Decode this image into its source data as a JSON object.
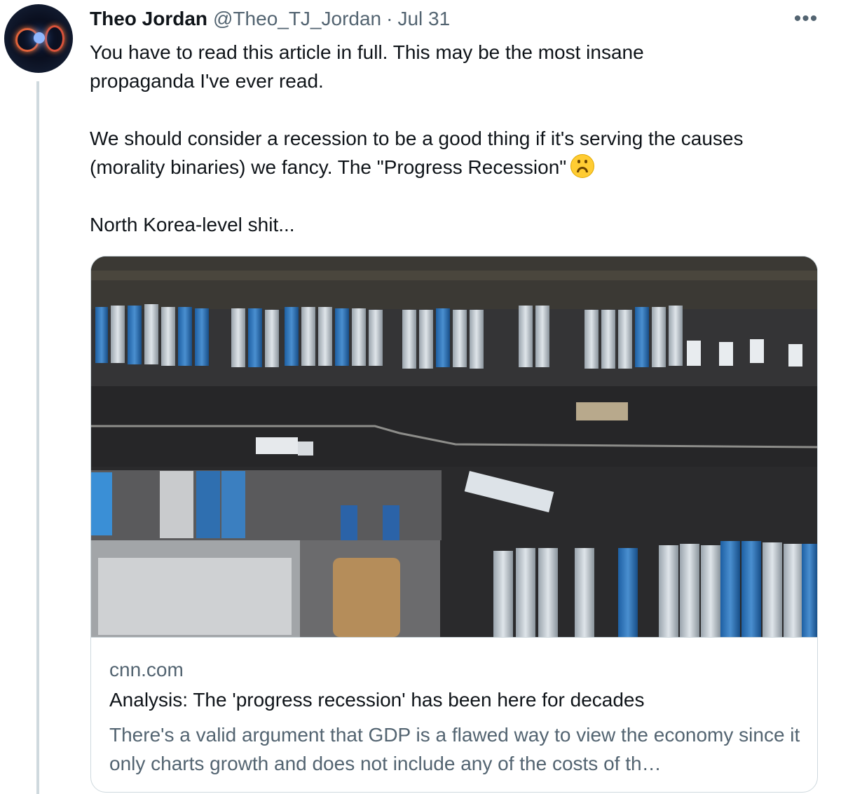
{
  "tweet": {
    "author_name": "Theo Jordan",
    "handle": "@Theo_TJ_Jordan",
    "separator": "·",
    "date": "Jul 31",
    "more_label": "•••",
    "text_lines": [
      "You have to read this article in full. This may be the most insane",
      "propaganda I've ever read.",
      "We should consider a recession to be a good thing if it's serving the causes",
      "(morality binaries) we fancy. The \"Progress Recession\"",
      "North Korea-level shit..."
    ],
    "emoji_icon": "upside-down-face"
  },
  "link_card": {
    "domain": "cnn.com",
    "title": "Analysis: The 'progress recession' has been here for decades",
    "description": "There's a valid argument that GDP is a flawed way to view the economy since it only charts growth and does not include any of the costs of th…",
    "image_icon": "aerial-truck-depot-photo"
  },
  "colors": {
    "text_primary": "#0f1419",
    "text_secondary": "#536471",
    "border": "#cfd9de"
  }
}
